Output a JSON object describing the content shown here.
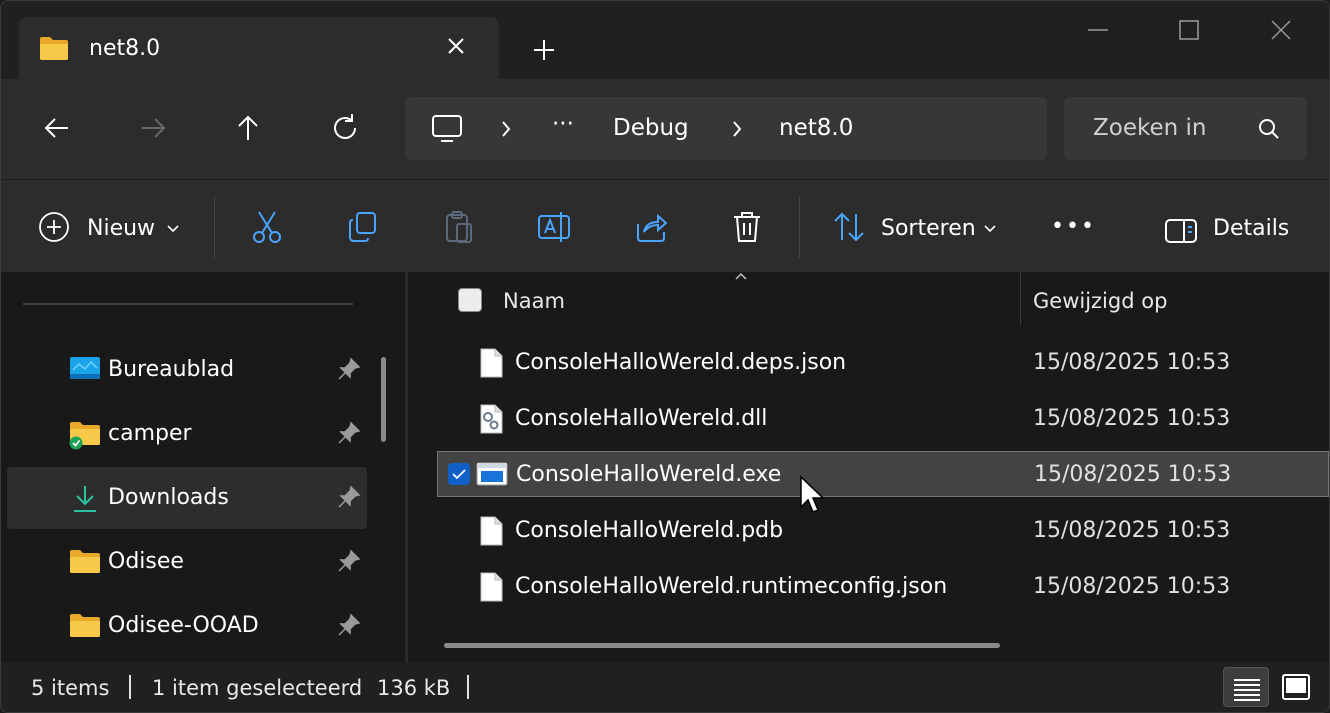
{
  "tab": {
    "title": "net8.0",
    "icon": "folder-icon"
  },
  "nav": {
    "back": "back-arrow-icon",
    "forward": "forward-arrow-icon",
    "up": "up-arrow-icon",
    "refresh": "refresh-icon"
  },
  "address": {
    "ellipsis": "···",
    "crumbs": [
      "Debug",
      "net8.0"
    ]
  },
  "search": {
    "placeholder": "Zoeken in"
  },
  "toolbar": {
    "new_label": "Nieuw",
    "sort_label": "Sorteren",
    "more_label": "•••",
    "details_label": "Details"
  },
  "sidebar": {
    "items": [
      {
        "label": "Bureaublad",
        "icon": "desktop-icon"
      },
      {
        "label": "camper",
        "icon": "synced-folder-icon"
      },
      {
        "label": "Downloads",
        "icon": "download-icon",
        "selected": true
      },
      {
        "label": "Odisee",
        "icon": "folder-icon"
      },
      {
        "label": "Odisee-OOAD",
        "icon": "folder-icon"
      }
    ]
  },
  "columns": {
    "name": "Naam",
    "modified": "Gewijzigd op"
  },
  "files": [
    {
      "name": "ConsoleHalloWereld.deps.json",
      "modified": "15/08/2025 10:53",
      "icon": "file-icon"
    },
    {
      "name": "ConsoleHalloWereld.dll",
      "modified": "15/08/2025 10:53",
      "icon": "dll-file-icon"
    },
    {
      "name": "ConsoleHalloWereld.exe",
      "modified": "15/08/2025 10:53",
      "icon": "exe-file-icon",
      "selected": true
    },
    {
      "name": "ConsoleHalloWereld.pdb",
      "modified": "15/08/2025 10:53",
      "icon": "file-icon"
    },
    {
      "name": "ConsoleHalloWereld.runtimeconfig.json",
      "modified": "15/08/2025 10:53",
      "icon": "file-icon"
    }
  ],
  "status": {
    "count": "5 items",
    "selection": "1 item geselecteerd",
    "size": "136 kB"
  },
  "colors": {
    "accent": "#1060c8",
    "selection_bg": "#434343"
  }
}
